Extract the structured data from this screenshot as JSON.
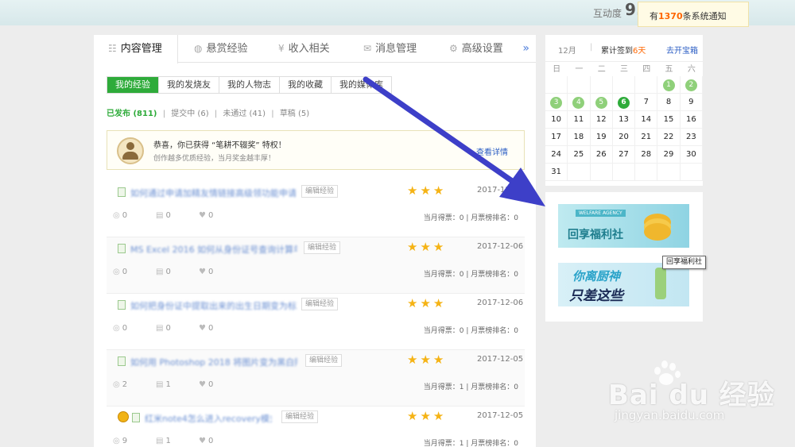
{
  "topbar": {
    "hudong_label": "互动度",
    "score": "9."
  },
  "notice": {
    "prefix": "有",
    "count": "1370",
    "suffix": "条系统通知"
  },
  "tabs": [
    {
      "label": "内容管理",
      "icon": "list-icon"
    },
    {
      "label": "悬赏经验",
      "icon": "coin-icon"
    },
    {
      "label": "收入相关",
      "icon": "yen-icon"
    },
    {
      "label": "消息管理",
      "icon": "mail-icon"
    },
    {
      "label": "高级设置",
      "icon": "gear-icon"
    }
  ],
  "more_label": "»",
  "subtabs": [
    "我的经验",
    "我的发烧友",
    "我的人物志",
    "我的收藏",
    "我的媒体库"
  ],
  "filters": [
    {
      "label": "已发布 (811)"
    },
    {
      "label": "提交中 (6)"
    },
    {
      "label": "未通过 (41)"
    },
    {
      "label": "草稿 (5)"
    }
  ],
  "filter_sep": "|",
  "award": {
    "line1": "恭喜，你已获得 “笔耕不辍奖” 特权！",
    "line2": "创作越多优质经验，当月奖金越丰厚！",
    "link": "查看详情"
  },
  "rows": [
    {
      "title": "如何通过申请加精友情链接高级领功能申请",
      "edit": "编辑经验",
      "stars": "★★★",
      "date": "2017-12-0",
      "views": "0",
      "likes": "0",
      "hearts": "0",
      "votes": "当月得票：0 | 月票榜排名：0"
    },
    {
      "title": "MS Excel 2016 如何从身份证号查询计算年龄",
      "edit": "编辑经验",
      "stars": "★★★",
      "date": "2017-12-06",
      "views": "0",
      "likes": "0",
      "hearts": "0",
      "votes": "当月得票：0 | 月票榜排名：0"
    },
    {
      "title": "如何把身份证中提取出来的出生日期变为标准日期",
      "edit": "编辑经验",
      "stars": "★★★",
      "date": "2017-12-06",
      "views": "0",
      "likes": "0",
      "hearts": "0",
      "votes": "当月得票：0 | 月票榜排名：0"
    },
    {
      "title": "如何用 Photoshop 2018 将图片变为黑白照片",
      "edit": "编辑经验",
      "stars": "★★★",
      "date": "2017-12-05",
      "views": "2",
      "likes": "1",
      "hearts": "0",
      "votes": "当月得票：1 | 月票榜排名：0"
    },
    {
      "title": "红米note4怎么进入recovery模式",
      "edit": "编辑经验",
      "stars": "★★★",
      "date": "2017-12-05",
      "views": "9",
      "likes": "1",
      "hearts": "0",
      "votes": "当月得票：1 | 月票榜排名：0"
    }
  ],
  "calendar": {
    "month": "12月",
    "sign_prefix": "累计签到",
    "sign_days": "6天",
    "open_label": "去开宝箱",
    "weekdays": [
      "日",
      "一",
      "二",
      "三",
      "四",
      "五",
      "六"
    ],
    "weeks": [
      [
        "",
        "",
        "",
        "",
        "",
        "1",
        "2"
      ],
      [
        "3",
        "4",
        "5",
        "6",
        "7",
        "8",
        "9"
      ],
      [
        "10",
        "11",
        "12",
        "13",
        "14",
        "15",
        "16"
      ],
      [
        "17",
        "18",
        "19",
        "20",
        "21",
        "22",
        "23"
      ],
      [
        "24",
        "25",
        "26",
        "27",
        "28",
        "29",
        "30"
      ],
      [
        "31",
        "",
        "",
        "",
        "",
        "",
        ""
      ]
    ],
    "signed_days": [
      "1",
      "2",
      "3",
      "4",
      "5"
    ],
    "today": "6"
  },
  "ads": {
    "ad1_tag": "WELFARE AGENCY",
    "ad1_text": "回享福利社",
    "ad2_line1": "你离厨神",
    "ad2_line2": "只差这些"
  },
  "tooltip": "回享福利社",
  "watermark": {
    "brand": "Bai  du 经验",
    "url": "jingyan.baidu.com"
  },
  "colors": {
    "accent_green": "#2eab3a",
    "link_blue": "#2d5fc4",
    "annotation_arrow": "#3d3fc8",
    "star": "#f5b315"
  }
}
